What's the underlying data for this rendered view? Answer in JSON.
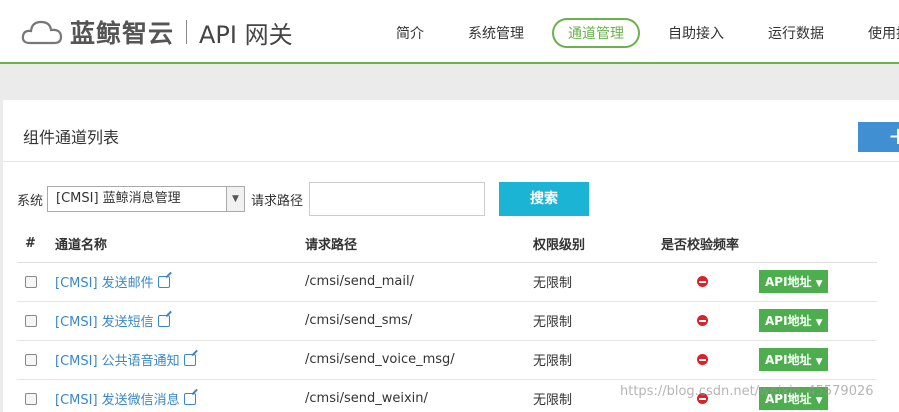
{
  "header": {
    "brand": "蓝鲸智云",
    "product": "API 网关",
    "nav": [
      {
        "label": "简介",
        "active": false
      },
      {
        "label": "系统管理",
        "active": false
      },
      {
        "label": "通道管理",
        "active": true
      },
      {
        "label": "自助接入",
        "active": false
      },
      {
        "label": "运行数据",
        "active": false
      },
      {
        "label": "使用指南",
        "active": false
      }
    ]
  },
  "panel": {
    "title": "组件通道列表",
    "add_label": "+"
  },
  "search": {
    "system_label": "系统",
    "system_value": "[CMSI] 蓝鲸消息管理",
    "path_label": "请求路径",
    "path_value": "",
    "button_label": "搜索"
  },
  "table": {
    "headers": [
      "#",
      "通道名称",
      "请求路径",
      "权限级别",
      "是否校验频率",
      ""
    ],
    "rows": [
      {
        "name": "[CMSI] 发送邮件",
        "path": "/cmsi/send_mail/",
        "level": "无限制",
        "api_label": "API地址"
      },
      {
        "name": "[CMSI] 发送短信",
        "path": "/cmsi/send_sms/",
        "level": "无限制",
        "api_label": "API地址"
      },
      {
        "name": "[CMSI] 公共语音通知",
        "path": "/cmsi/send_voice_msg/",
        "level": "无限制",
        "api_label": "API地址"
      },
      {
        "name": "[CMSI] 发送微信消息",
        "path": "/cmsi/send_weixin/",
        "level": "无限制",
        "api_label": "API地址"
      }
    ]
  },
  "watermark": "https://blog.csdn.net/weixin_45579026",
  "colors": {
    "accent": "#6ab04c",
    "link": "#3a87c8",
    "search": "#1cb4d4",
    "api": "#4cae4c"
  }
}
